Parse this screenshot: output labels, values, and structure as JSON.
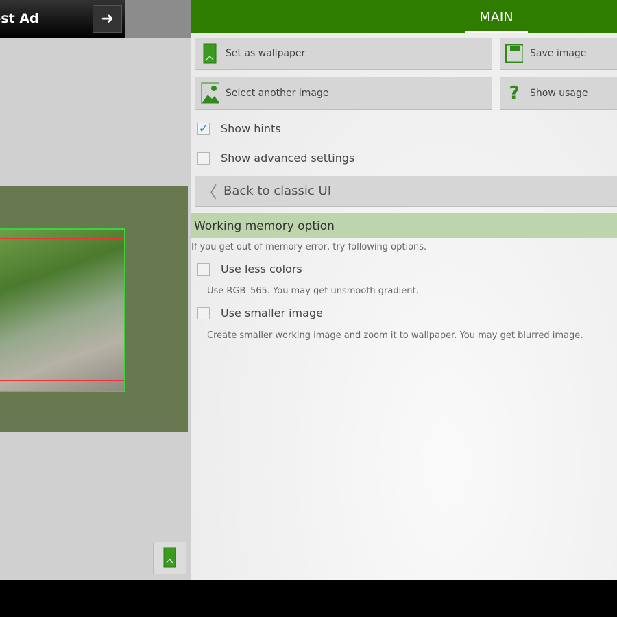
{
  "ad": {
    "label": "Test Ad",
    "next_icon": "arrow-right-icon"
  },
  "header": {
    "tab": "MAIN"
  },
  "buttons": {
    "set_wallpaper": "Set as wallpaper",
    "save_image": "Save image",
    "select_image": "Select another image",
    "show_usage": "Show usage",
    "back": "Back to classic UI"
  },
  "options": {
    "show_hints": {
      "label": "Show hints",
      "checked": true
    },
    "advanced": {
      "label": "Show advanced settings",
      "checked": false
    }
  },
  "section": {
    "title": "Working memory option",
    "description": "If you get out of memory error, try following options.",
    "items": [
      {
        "label": "Use less colors",
        "checked": false,
        "hint": "Use RGB_565. You may get unsmooth gradient."
      },
      {
        "label": "Use smaller image",
        "checked": false,
        "hint": "Create smaller working image and zoom it to wallpaper. You may get blurred image."
      }
    ]
  },
  "colors": {
    "accent": "#2e7d00",
    "section_bg": "#bdd4ad",
    "preview_bg": "#68784f"
  }
}
